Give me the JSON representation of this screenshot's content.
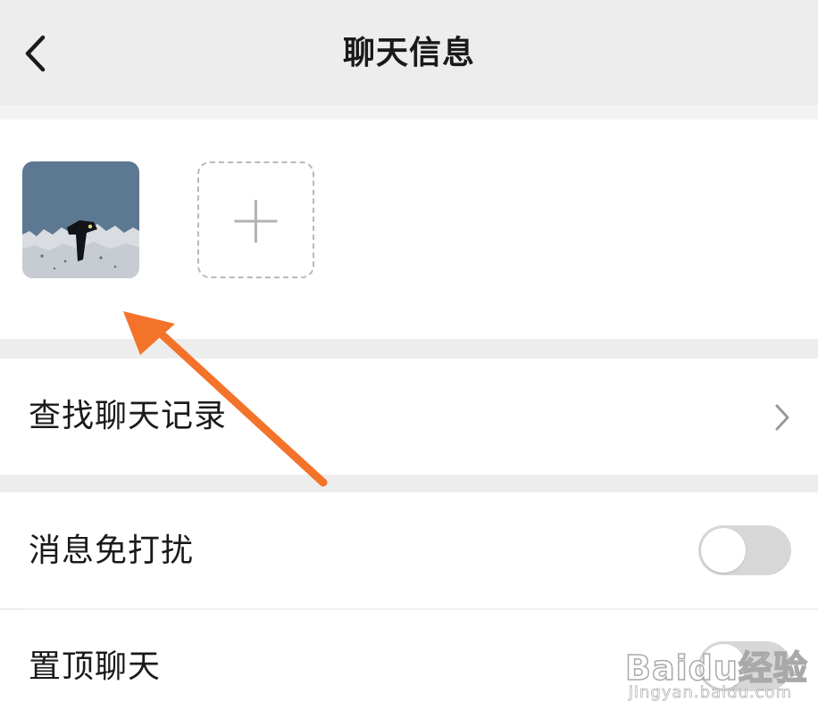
{
  "header": {
    "title": "聊天信息",
    "back_icon": "chevron-left-icon"
  },
  "members": {
    "avatar_icon": "user-avatar",
    "add_icon": "plus-icon"
  },
  "rows": {
    "search_history": {
      "label": "查找聊天记录",
      "icon": "chevron-right-icon"
    },
    "mute": {
      "label": "消息免打扰",
      "on": false
    },
    "pin": {
      "label": "置顶聊天",
      "on": false
    }
  },
  "annotation": {
    "type": "arrow",
    "color": "#f4732b"
  },
  "watermark": {
    "brand": "Baidu经验",
    "url": "jingyan.baidu.com"
  },
  "colors": {
    "background": "#ededed",
    "surface": "#ffffff",
    "text": "#1a1a1a",
    "toggle_off": "#d7d7d7"
  }
}
